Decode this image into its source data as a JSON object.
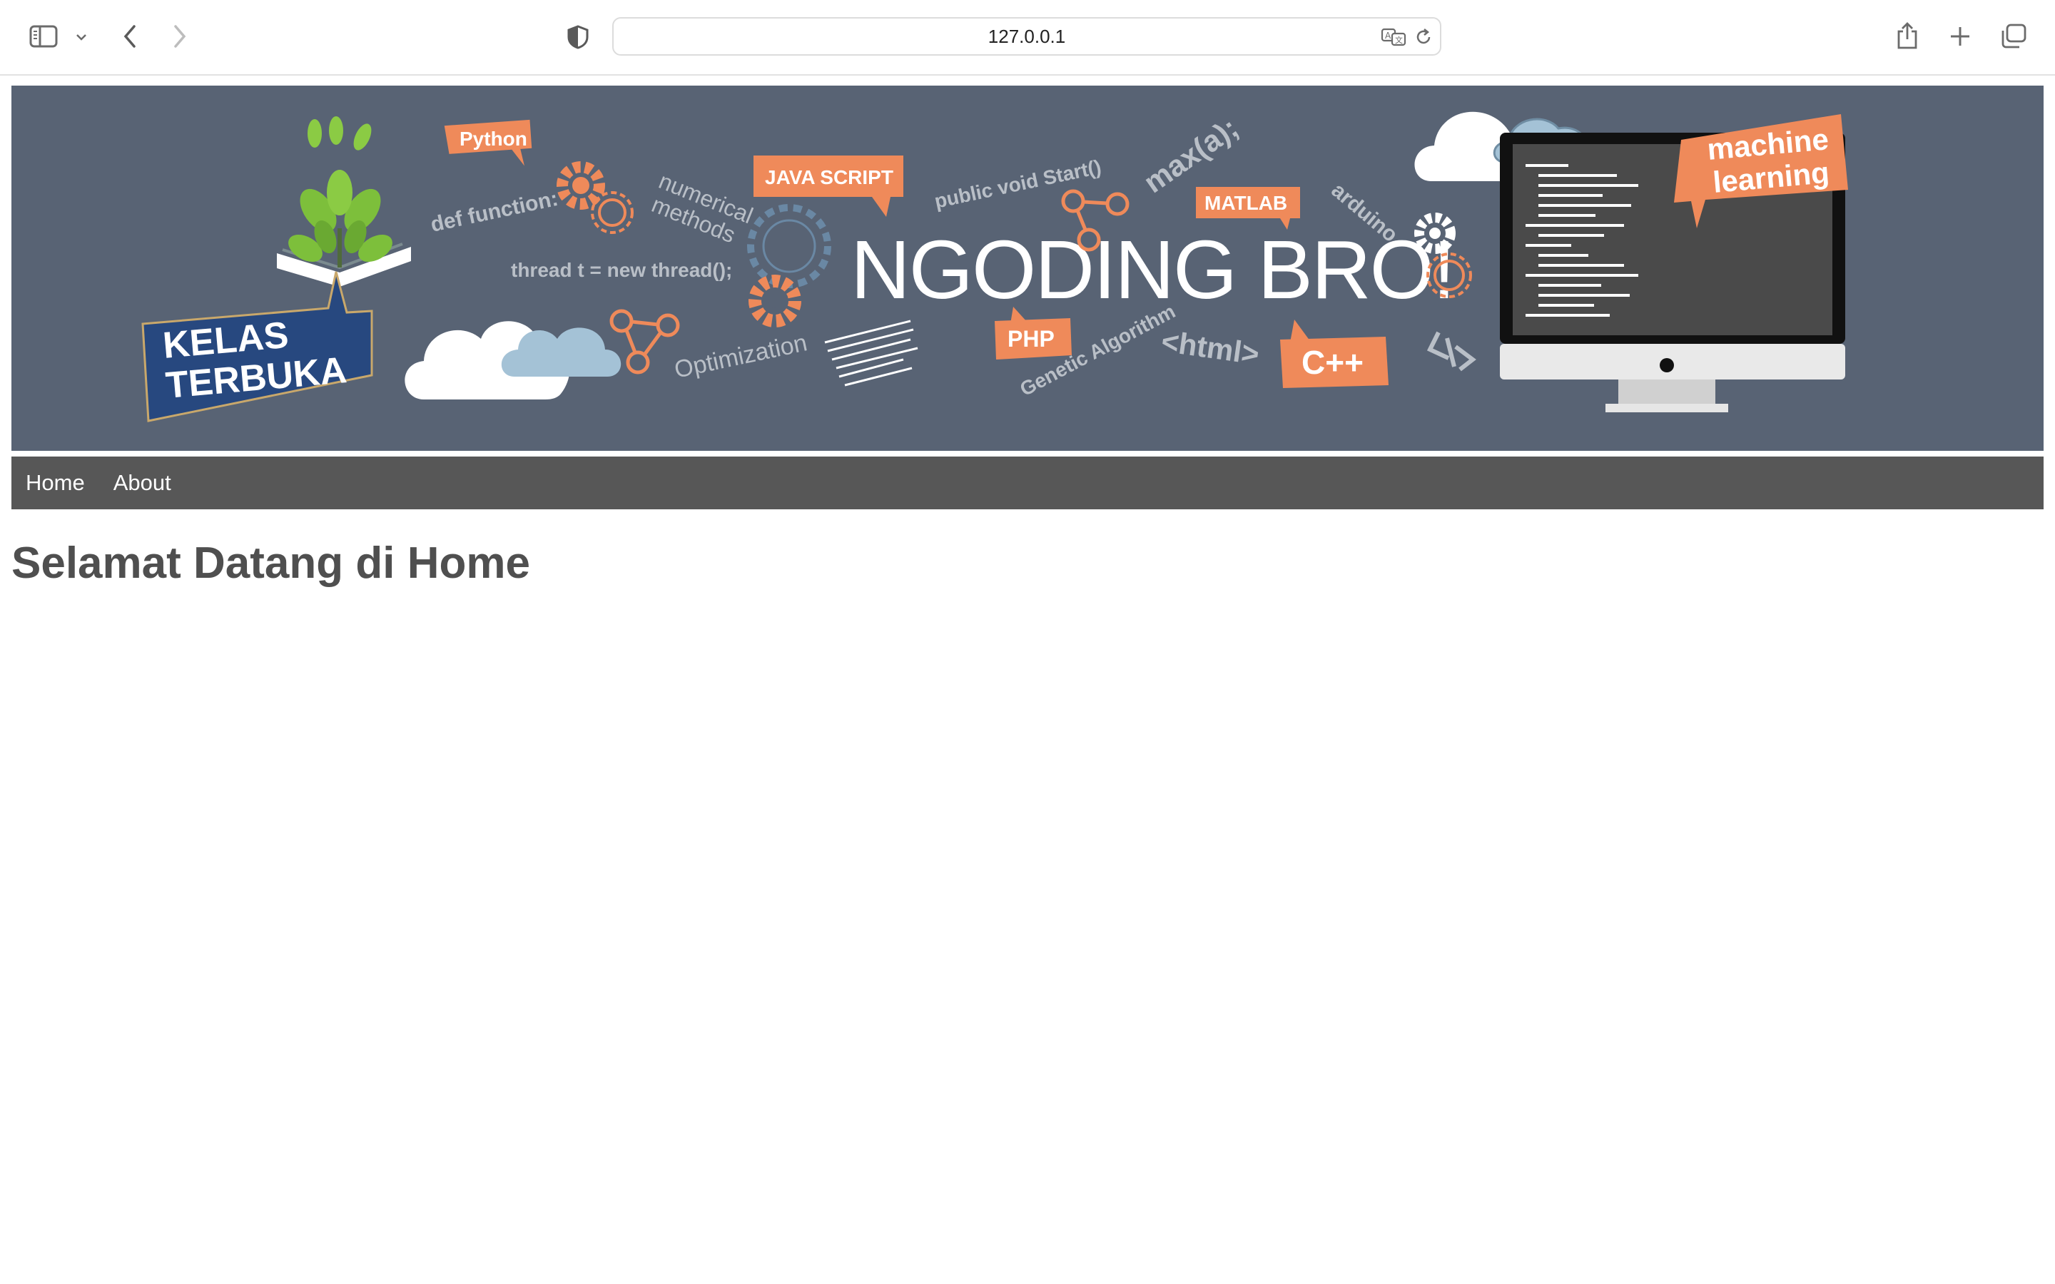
{
  "browser": {
    "url": "127.0.0.1",
    "icons": {
      "sidebar": "sidebar-icon",
      "sidebar_menu": "chevron-down-icon",
      "back": "chevron-left-icon",
      "forward": "chevron-right-icon",
      "privacy": "shield-icon",
      "translate": "translate-icon",
      "reload": "reload-icon",
      "share": "share-icon",
      "new_tab": "plus-icon",
      "tabs": "tab-overview-icon"
    }
  },
  "banner": {
    "headline": "NGODING BRO!",
    "badge_line1": "KELAS",
    "badge_line2": "TERBUKA",
    "tags": {
      "python": "Python",
      "javascript": "JAVA SCRIPT",
      "matlab": "MATLAB",
      "php": "PHP",
      "cpp": "C++",
      "ml_line1": "machine",
      "ml_line2": "learning"
    },
    "texts": {
      "def_function": "def function:",
      "numerical": "numerical",
      "methods": "methods",
      "public_void": "public void Start()",
      "max": "max(a);",
      "arduino": "arduino",
      "thread": "thread t = new thread();",
      "optimization": "Optimization",
      "genetic": "Genetic Algorithm",
      "html": "<html>"
    },
    "colors": {
      "background": "#586374",
      "accent": "#ef8a5a",
      "badge": "#27487f",
      "leaf": "#7dbf3b",
      "cloud_blue": "#a4c2d6"
    }
  },
  "nav": {
    "items": [
      {
        "label": "Home"
      },
      {
        "label": "About"
      }
    ]
  },
  "main": {
    "title": "Selamat Datang di Home"
  }
}
